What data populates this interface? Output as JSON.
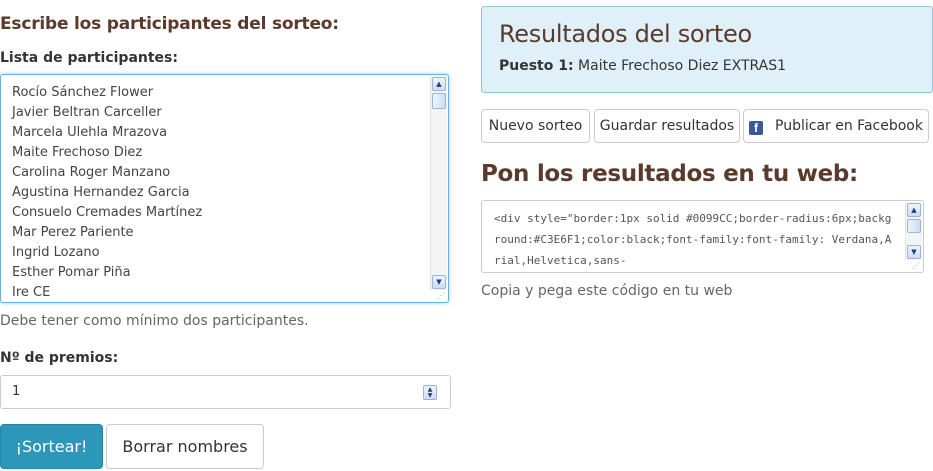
{
  "left": {
    "heading": "Escribe los participantes del sorteo:",
    "list_label": "Lista de participantes:",
    "participants": [
      "Rocío Sánchez Flower",
      "Javier Beltran Carceller",
      "Marcela Ulehla Mrazova",
      "Maite Frechoso Diez",
      "Carolina Roger Manzano",
      "Agustina Hernandez Garcia",
      "Consuelo Cremades Martínez",
      "Mar Perez Pariente",
      "Ingrid Lozano",
      "Esther Pomar Piña",
      "Ire CE"
    ],
    "help_text": "Debe tener como mínimo dos participantes.",
    "prizes_label": "Nº de premios:",
    "prizes_value": "1",
    "draw_button": "¡Sortear!",
    "clear_button": "Borrar nombres"
  },
  "results": {
    "heading": "Resultados del sorteo",
    "position_label": "Puesto 1:",
    "position_value": " Maite Frechoso Diez EXTRAS1"
  },
  "actions": {
    "new_draw": "Nuevo sorteo",
    "save_results": "Guardar resultados",
    "facebook": "Publicar en Facebook"
  },
  "embed": {
    "heading": "Pon los resultados en tu web:",
    "code": "<div style=\"border:1px solid #0099CC;border-radius:6px;background:#C3E6F1;color:black;font-family:font-family: Verdana,Arial,Helvetica,sans-",
    "copy_help": "Copia y pega este código en tu web"
  },
  "colors": {
    "primary": "#2c97b8",
    "heading": "#5a3a2a",
    "panel_bg": "#dff0f8",
    "facebook": "#3b5998"
  },
  "icons": [
    "facebook-icon",
    "scroll-up-icon",
    "scroll-down-icon",
    "spin-icon",
    "resize-grip-icon"
  ]
}
